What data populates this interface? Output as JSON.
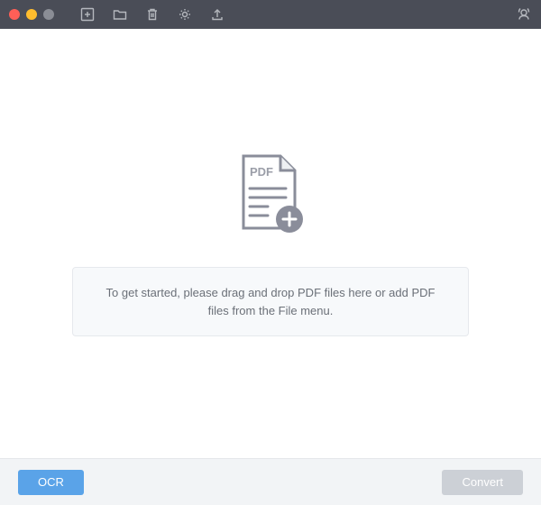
{
  "main": {
    "pdf_label": "PDF",
    "instruction_text": "To get started, please drag and drop PDF files here or add PDF files from the File menu."
  },
  "footer": {
    "ocr_label": "OCR",
    "convert_label": "Convert"
  }
}
